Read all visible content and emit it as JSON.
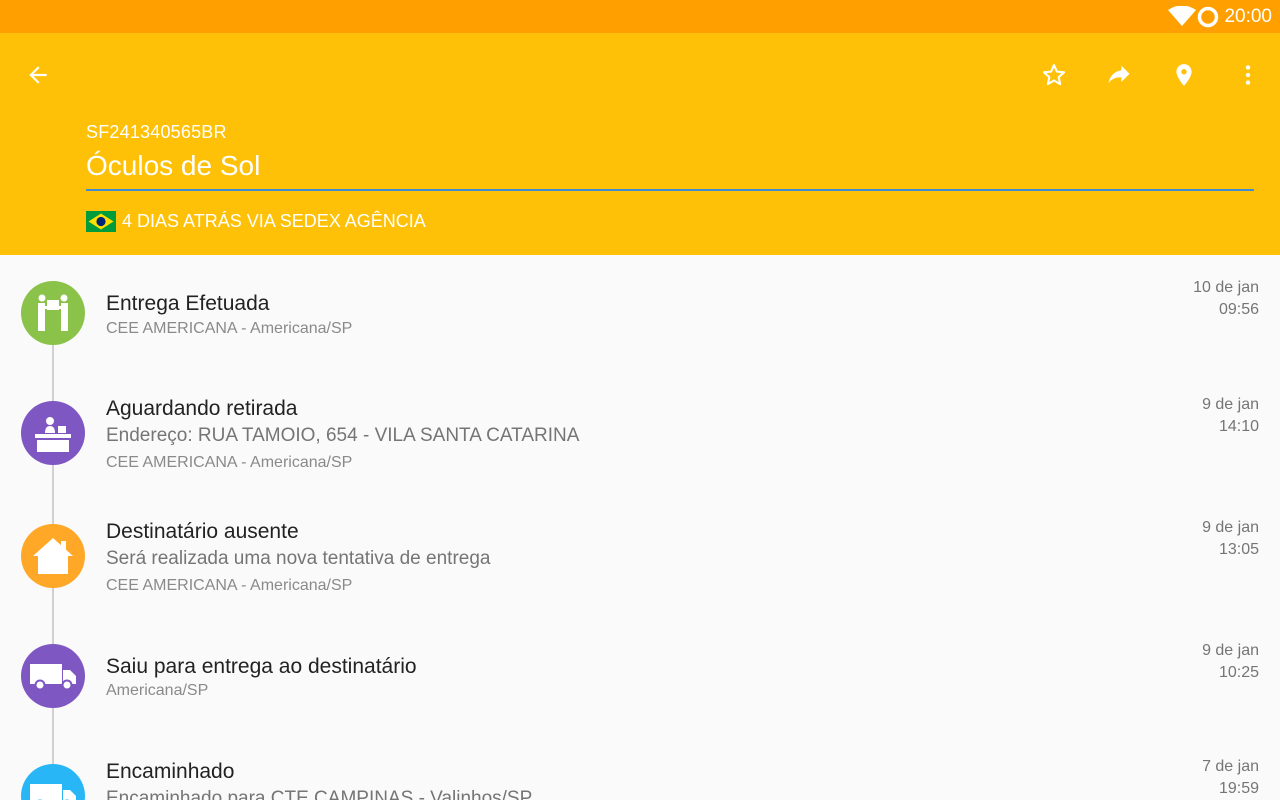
{
  "status_bar": {
    "time": "20:00"
  },
  "header": {
    "tracking_code": "SF241340565BR",
    "package_name": "Óculos de Sol",
    "meta": "4 DIAS ATRÁS VIA SEDEX AGÊNCIA"
  },
  "colors": {
    "status_bar": "#ffa000",
    "app_bar": "#ffc107",
    "delivered": "#8bc34a",
    "pickup": "#7e57c2",
    "absent": "#ffa726",
    "out_for_delivery": "#7e57c2",
    "forwarded": "#29b6f6"
  },
  "events": [
    {
      "icon": "handover-icon",
      "title": "Entrega Efetuada",
      "location": "CEE AMERICANA - Americana/SP",
      "date": "10 de jan",
      "time": "09:56"
    },
    {
      "icon": "counter-icon",
      "title": "Aguardando retirada",
      "detail": "Endereço: RUA TAMOIO, 654 - VILA SANTA CATARINA",
      "location": "CEE AMERICANA - Americana/SP",
      "date": "9 de jan",
      "time": "14:10"
    },
    {
      "icon": "house-icon",
      "title": "Destinatário ausente",
      "detail": "Será realizada uma nova tentativa de entrega",
      "location": "CEE AMERICANA - Americana/SP",
      "date": "9 de jan",
      "time": "13:05"
    },
    {
      "icon": "truck-icon",
      "title": "Saiu para entrega ao destinatário",
      "location": "Americana/SP",
      "date": "9 de jan",
      "time": "10:25"
    },
    {
      "icon": "truck-icon",
      "title": "Encaminhado",
      "detail": "Encaminhado para CTE CAMPINAS - Valinhos/SP",
      "date": "7 de jan",
      "time": "19:59"
    }
  ]
}
